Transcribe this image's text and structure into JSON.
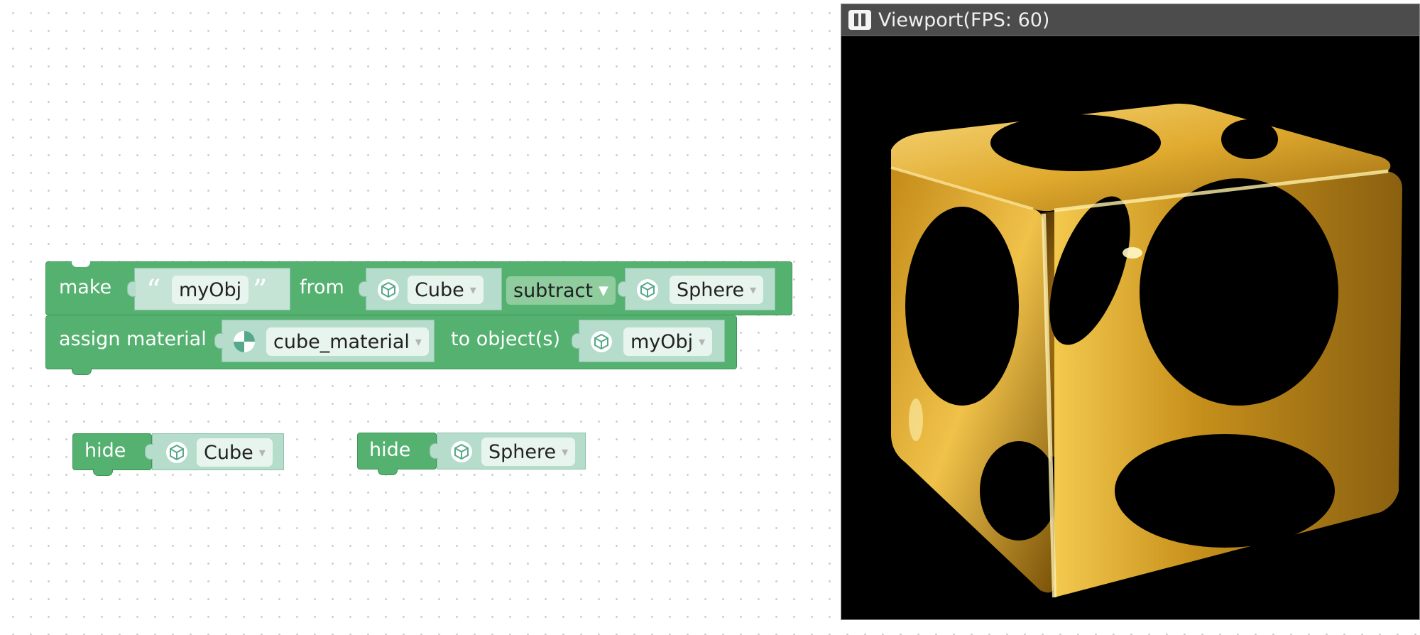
{
  "workspace": {
    "make_block": {
      "keyword": "make",
      "name_value": "myObj",
      "from_label": "from",
      "first_object": "Cube",
      "operation": "subtract",
      "second_object": "Sphere"
    },
    "assign_block": {
      "keyword": "assign material",
      "material": "cube_material",
      "to_label": "to object(s)",
      "target": "myObj"
    },
    "hide_blocks": [
      {
        "keyword": "hide",
        "object": "Cube"
      },
      {
        "keyword": "hide",
        "object": "Sphere"
      }
    ],
    "dropdown_arrow": "▾",
    "icons": {
      "object": "cube-icon",
      "material": "material-ball-icon",
      "quote": "quote-icon"
    }
  },
  "viewport": {
    "title": "Viewport(FPS: 60)",
    "button_icon": "pause-icon",
    "scene": "gold cube with spherical cutouts",
    "colors": {
      "background": "#000000",
      "gold": "#d4a020"
    }
  },
  "colors": {
    "block": "#55b170",
    "socket": "#b6dccb",
    "pill": "#e8f5ee",
    "titlebar": "#4c4c4c"
  }
}
